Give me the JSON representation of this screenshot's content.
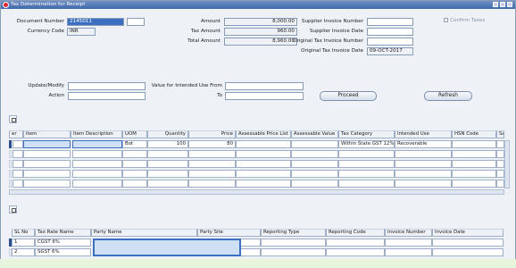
{
  "window": {
    "title": "Tax Determination for Receipt"
  },
  "header": {
    "document_number_label": "Document Number",
    "document_number": "2145011",
    "currency_code_label": "Currency Code",
    "currency_code": "INR",
    "amount_label": "Amount",
    "amount": "8,000.00",
    "tax_amount_label": "Tax Amount",
    "tax_amount": "960.00",
    "total_amount_label": "Total Amount",
    "total_amount": "8,960.00",
    "supplier_invoice_number_label": "Supplier Invoice Number",
    "supplier_invoice_number": "",
    "supplier_invoice_date_label": "Supplier Invoice Date",
    "supplier_invoice_date": "",
    "original_tax_invoice_number_label": "Original Tax Invoice Number",
    "original_tax_invoice_number": "",
    "original_tax_invoice_date_label": "Original Tax Invoice Date",
    "original_tax_invoice_date": "09-OCT-2017",
    "confirm_taxes_label": "Confirm Taxes"
  },
  "update": {
    "update_modify_label": "Update/Modify",
    "update_modify": "",
    "action_label": "Action",
    "action": "",
    "value_intended_use_from_label": "Value for Intended Use From",
    "value_intended_use_from": "",
    "to_label": "To",
    "to": "",
    "proceed_label": "Proceed",
    "refresh_label": "Refresh"
  },
  "lines_table": {
    "columns": [
      "er",
      "Item",
      "Item Description",
      "UOM",
      "Quantity",
      "Price",
      "Assessable Price List",
      "Assessable Value",
      "Tax Category",
      "Intended Use",
      "HSN Code",
      "Sa"
    ],
    "rows": [
      [
        "",
        "",
        "",
        "Bot",
        "100",
        "80",
        "",
        "",
        "Within State GST 12%",
        "Recoverable",
        "",
        ""
      ]
    ]
  },
  "tax_table": {
    "columns": [
      "SL No",
      "Tax Rate Name",
      "Party Name",
      "Party Site",
      "Reporting Type",
      "Reporting Code",
      "Invoice Number",
      "Invoice Date"
    ],
    "rows": [
      [
        "1",
        "CGST 6%",
        "",
        "",
        "",
        "",
        "",
        ""
      ],
      [
        "2",
        "SGST 6%",
        "",
        "",
        "",
        "",
        "",
        ""
      ]
    ]
  }
}
